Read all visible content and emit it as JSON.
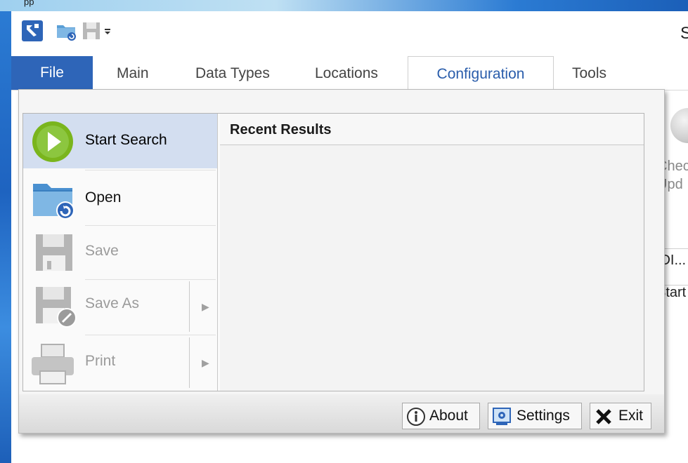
{
  "window": {
    "title_visible": "S",
    "desktop_title": "pp"
  },
  "quick_access": {
    "icons": [
      "app-logo-icon",
      "open-folder-icon",
      "save-disk-icon",
      "customize-dropdown-icon"
    ]
  },
  "tabs": [
    {
      "label": "File",
      "active": true
    },
    {
      "label": "Main"
    },
    {
      "label": "Data Types"
    },
    {
      "label": "Locations"
    },
    {
      "label": "Configuration",
      "selected": true
    },
    {
      "label": "Tools"
    }
  ],
  "ribbon_background": {
    "check_updates_line1": "Chec",
    "check_updates_line2": "Upd",
    "odi_text": "DDI...",
    "start_text": "Start"
  },
  "file_menu": {
    "items": [
      {
        "label": "Start Search",
        "icon": "play-icon",
        "state": "selected"
      },
      {
        "label": "Open",
        "icon": "open-folder-icon",
        "state": "enabled"
      },
      {
        "label": "Save",
        "icon": "save-icon",
        "state": "disabled"
      },
      {
        "label": "Save As",
        "icon": "save-as-icon",
        "state": "disabled",
        "has_submenu": true
      },
      {
        "label": "Print",
        "icon": "printer-icon",
        "state": "disabled",
        "has_submenu": true
      }
    ],
    "recent_results_title": "Recent Results",
    "bottom_buttons": [
      {
        "label": "About",
        "icon": "info-icon"
      },
      {
        "label": "Settings",
        "icon": "settings-icon"
      },
      {
        "label": "Exit",
        "icon": "close-x-icon"
      }
    ]
  },
  "colors": {
    "file_tab": "#2e65b8",
    "selected_item": "#d3def0",
    "play_green": "#7ab51d",
    "config_tab_text": "#2a5dab"
  }
}
